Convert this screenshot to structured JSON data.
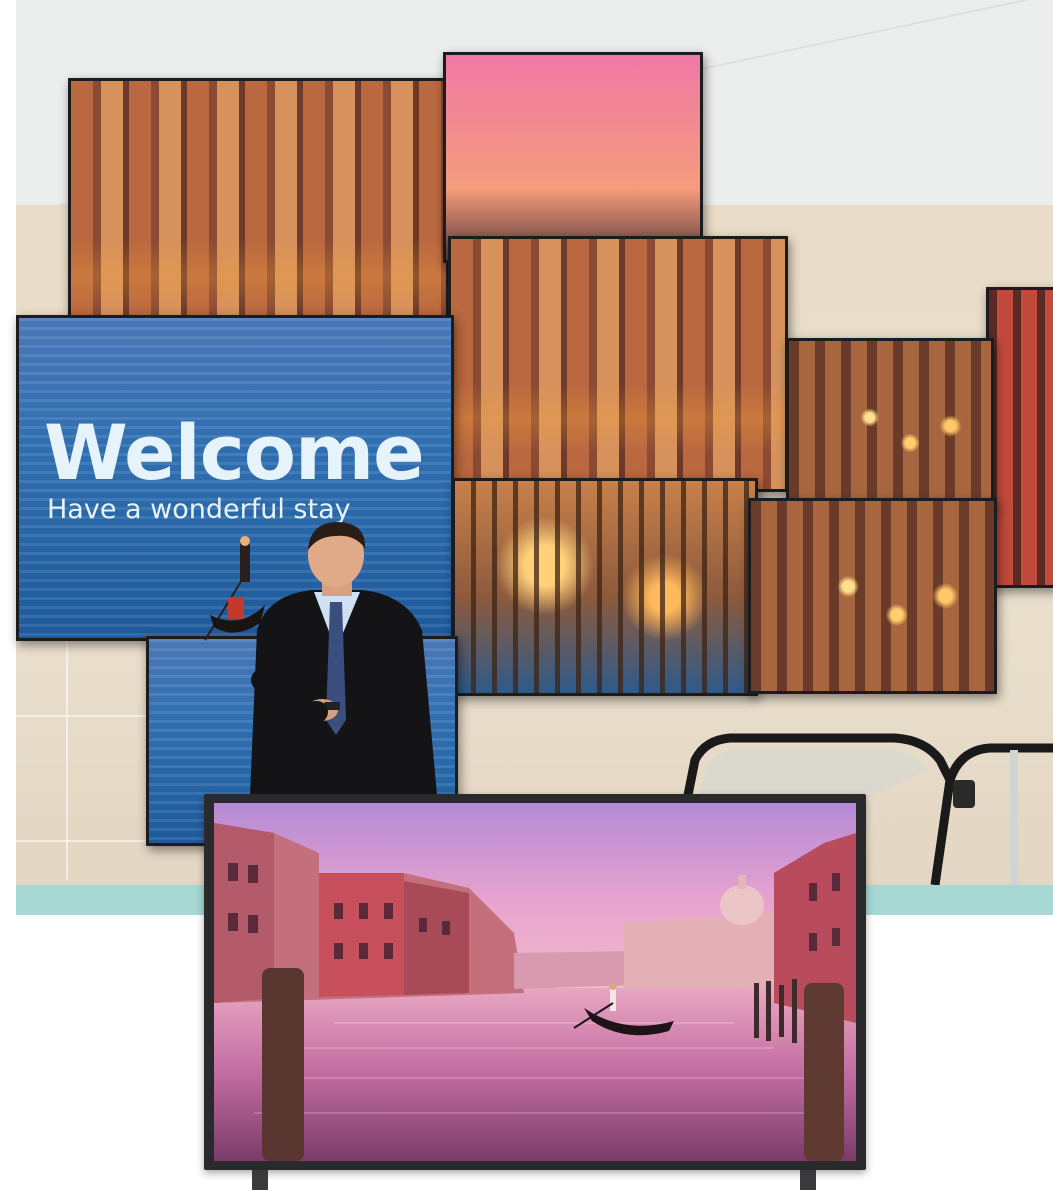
{
  "welcome": {
    "title": "Welcome",
    "subtitle": "Have a wonderful stay"
  },
  "colors": {
    "accent_strip": "#a7d8d4",
    "tv_bezel": "#2a2a2c",
    "sign_text": "#e7f3fb"
  }
}
